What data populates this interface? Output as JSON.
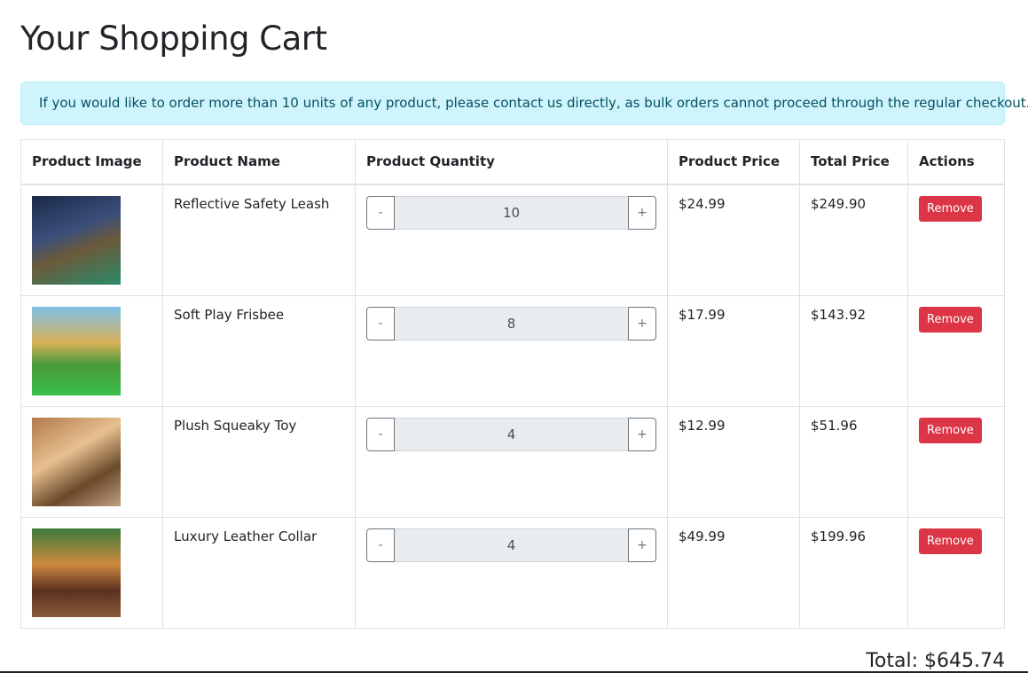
{
  "title": "Your Shopping Cart",
  "alert": "If you would like to order more than 10 units of any product, please contact us directly, as bulk orders cannot proceed through the regular checkout.",
  "headers": [
    "Product Image",
    "Product Name",
    "Product Quantity",
    "Product Price",
    "Total Price",
    "Actions"
  ],
  "minus": "-",
  "plus": "+",
  "remove": "Remove",
  "rows": [
    {
      "name": "Reflective Safety Leash",
      "qty": "10",
      "price": "$24.99",
      "total": "$249.90"
    },
    {
      "name": "Soft Play Frisbee",
      "qty": "8",
      "price": "$17.99",
      "total": "$143.92"
    },
    {
      "name": "Plush Squeaky Toy",
      "qty": "4",
      "price": "$12.99",
      "total": "$51.96"
    },
    {
      "name": "Luxury Leather Collar",
      "qty": "4",
      "price": "$49.99",
      "total": "$199.96"
    }
  ],
  "total": "Total: $645.74"
}
